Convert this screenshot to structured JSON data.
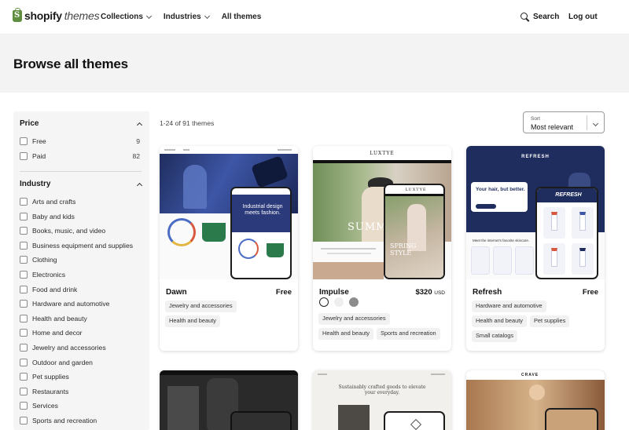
{
  "header": {
    "logo_word": "shopify",
    "logo_sub": "themes",
    "nav": [
      {
        "label": "Collections",
        "dropdown": true
      },
      {
        "label": "Industries",
        "dropdown": true
      },
      {
        "label": "All themes",
        "dropdown": false
      }
    ],
    "search_label": "Search",
    "logout_label": "Log out"
  },
  "hero": {
    "title": "Browse all themes"
  },
  "filters": {
    "price": {
      "title": "Price",
      "options": [
        {
          "label": "Free",
          "count": "9"
        },
        {
          "label": "Paid",
          "count": "82"
        }
      ]
    },
    "industry": {
      "title": "Industry",
      "options": [
        {
          "label": "Arts and crafts"
        },
        {
          "label": "Baby and kids"
        },
        {
          "label": "Books, music, and video"
        },
        {
          "label": "Business equipment and supplies"
        },
        {
          "label": "Clothing"
        },
        {
          "label": "Electronics"
        },
        {
          "label": "Food and drink"
        },
        {
          "label": "Hardware and automotive"
        },
        {
          "label": "Health and beauty"
        },
        {
          "label": "Home and decor"
        },
        {
          "label": "Jewelry and accessories"
        },
        {
          "label": "Outdoor and garden"
        },
        {
          "label": "Pet supplies"
        },
        {
          "label": "Restaurants"
        },
        {
          "label": "Services"
        },
        {
          "label": "Sports and recreation"
        }
      ]
    }
  },
  "results": {
    "count_text": "1-24 of 91 themes",
    "sort_label": "Sort",
    "sort_value": "Most relevant"
  },
  "themes": [
    {
      "name": "Dawn",
      "price": "Free",
      "currency": "",
      "tags": [
        "Jewelry and accessories",
        "Health and beauty"
      ],
      "preview_text": "Industrial design meets fashion."
    },
    {
      "name": "Impulse",
      "price": "$320",
      "currency": "USD",
      "swatches": [
        "#ffffff",
        "#eeeeee",
        "#8c8c8c"
      ],
      "tags": [
        "Jewelry and accessories",
        "Health and beauty",
        "Sports and recreation"
      ],
      "preview_brand": "LUXTYE",
      "preview_text": "SUMME",
      "preview_text2": "SPRING STYLE"
    },
    {
      "name": "Refresh",
      "price": "Free",
      "currency": "",
      "tags": [
        "Hardware and automotive",
        "Health and beauty",
        "Pet supplies",
        "Small catalogs"
      ],
      "preview_brand": "REFRESH",
      "preview_text": "Your hair, but better.",
      "preview_text2": "Meet the internet's favorite skincare."
    }
  ],
  "second_row": {
    "preview_text": "Sustainably crafted goods to elevate your everyday.",
    "preview_brand": "CRAVE"
  },
  "colors": {
    "brand_green": "#5e8e3e",
    "hero_bg": "#f3f3f3",
    "sidebar_bg": "#f5f5f5",
    "navy": "#1f2d5e"
  }
}
